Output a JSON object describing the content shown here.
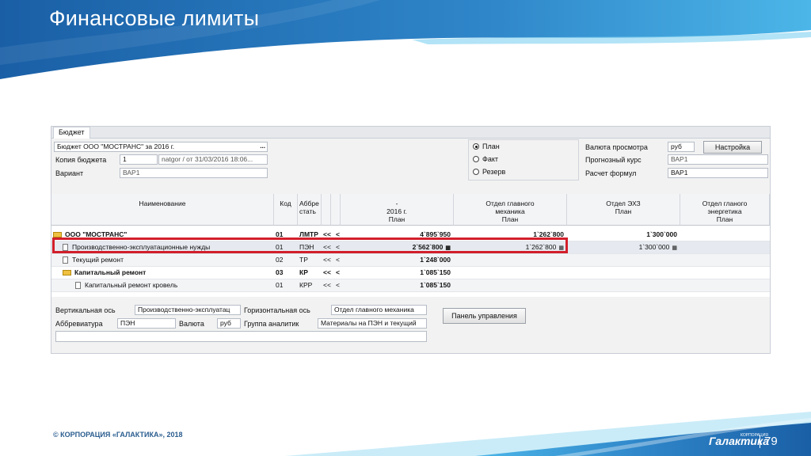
{
  "slide": {
    "title": "Финансовые лимиты",
    "copyright": "© КОРПОРАЦИЯ «ГАЛАКТИКА», 2018",
    "logo": "Галактика",
    "logo_sub": "КОРПОРАЦИЯ",
    "page_number": "79",
    "colors": {
      "header_blue": "#1b6fb6",
      "accent_cyan": "#3fb6e6",
      "highlight_red": "#d21f2b"
    }
  },
  "app": {
    "tab": "Бюджет",
    "budget_name": "Бюджет ООО \"МОСТРАНС\" за 2016 г.",
    "copy_label": "Копия бюджета",
    "copy_value": "1",
    "copy_info": "natgor / от 31/03/2016 18:06...",
    "variant_label": "Вариант",
    "variant_value": "ВАР1",
    "radio": {
      "options": [
        "План",
        "Факт",
        "Резерв"
      ],
      "selected": "План"
    },
    "currency_view_label": "Валюта просмотра",
    "currency_view_value": "руб",
    "settings_button": "Настройка",
    "forecast_rate_label": "Прогнозный курс",
    "forecast_rate_value": "ВАР1",
    "calc_formula_label": "Расчет формул",
    "calc_formula_value": "ВАР1",
    "more_icon": "ellipsis-icon"
  },
  "grid": {
    "headers": {
      "name": "Наименование",
      "code": "Код",
      "abbr": "Аббре стать",
      "dash_line1": "-",
      "dash_line2": "2016 г.",
      "dash_line3": "План",
      "col_mech_1": "Отдел главного",
      "col_mech_2": "механика",
      "col_mech_3": "План",
      "col_ehz_1": "Отдел ЭХЗ",
      "col_ehz_2": "План",
      "col_en_1": "Отдел гланого",
      "col_en_2": "энергетика",
      "col_en_3": "План"
    },
    "rows": [
      {
        "name": "ООО \"МОСТРАНС\"",
        "code": "01",
        "abbr": "ЛМТР",
        "a1": "<<",
        "a2": "<",
        "total": "4`895`950",
        "mech": "1`262`800",
        "ehz": "1`300`000",
        "en": ""
      },
      {
        "name": "Производственно-эксплуатационные нужды",
        "code": "01",
        "abbr": "ПЭН",
        "a1": "<<",
        "a2": "<",
        "total": "2`562`800",
        "mech": "1`262`800",
        "ehz": "1`300`000",
        "en": ""
      },
      {
        "name": "Текущий ремонт",
        "code": "02",
        "abbr": "ТР",
        "a1": "<<",
        "a2": "<",
        "total": "1`248`000",
        "mech": "",
        "ehz": "",
        "en": ""
      },
      {
        "name": "Капитальный ремонт",
        "code": "03",
        "abbr": "КР",
        "a1": "<<",
        "a2": "<",
        "total": "1`085`150",
        "mech": "",
        "ehz": "",
        "en": ""
      },
      {
        "name": "Капитальный ремонт кровель",
        "code": "01",
        "abbr": "КРР",
        "a1": "<<",
        "a2": "<",
        "total": "1`085`150",
        "mech": "",
        "ehz": "",
        "en": ""
      }
    ]
  },
  "bottom": {
    "vaxis_label": "Вертикальная ось",
    "vaxis_value": "Производственно-эксплуатац",
    "haxis_label": "Горизонтальная ось",
    "haxis_value": "Отдел главного механика",
    "abbr_label": "Аббревиатура",
    "abbr_value": "ПЭН",
    "currency_label": "Валюта",
    "currency_value": "руб",
    "group_label": "Группа аналитик",
    "group_value": "Материалы на ПЭН и текущий",
    "panel_button": "Панель управления"
  }
}
